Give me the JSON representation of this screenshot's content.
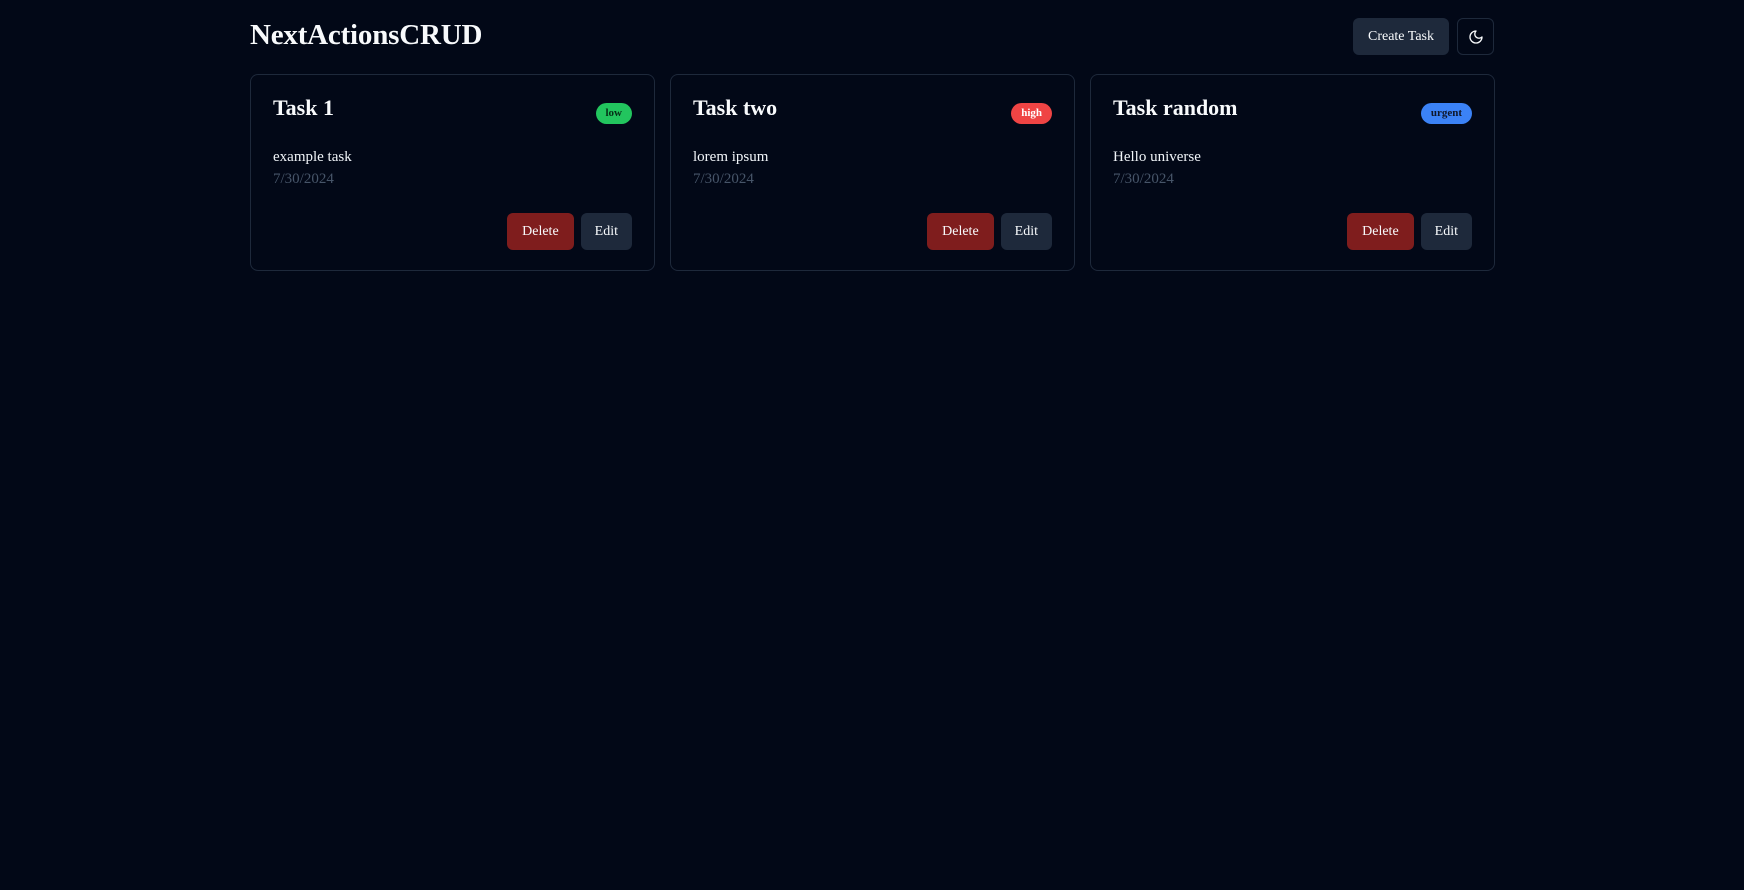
{
  "header": {
    "title": "NextActionsCRUD",
    "create_label": "Create Task",
    "theme_icon": "moon-icon"
  },
  "tasks": [
    {
      "title": "Task 1",
      "priority": "low",
      "description": "example task",
      "date": "7/30/2024",
      "delete_label": "Delete",
      "edit_label": "Edit"
    },
    {
      "title": "Task two",
      "priority": "high",
      "description": "lorem ipsum",
      "date": "7/30/2024",
      "delete_label": "Delete",
      "edit_label": "Edit"
    },
    {
      "title": "Task random",
      "priority": "urgent",
      "description": "Hello universe",
      "date": "7/30/2024",
      "delete_label": "Delete",
      "edit_label": "Edit"
    }
  ],
  "colors": {
    "background": "#020817",
    "low": "#22c55e",
    "high": "#ef4444",
    "urgent": "#3b82f6",
    "delete": "#7f1d1d",
    "secondary": "#1e293b"
  }
}
